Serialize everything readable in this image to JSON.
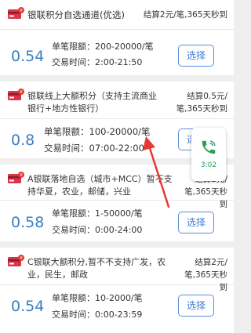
{
  "channels": [
    {
      "name": "银联积分自选通道(优选)",
      "settlement": "结算2元/笔,365天秒到",
      "rate": "0.54",
      "limit": "单笔限额：200-20000/笔",
      "hours": "交易时间：2:00-21:50",
      "button": "选择"
    },
    {
      "name": "银联线上大额积分（支持主流商业银行+地方性银行）",
      "settlement": "结算0.5元/笔,365天秒到",
      "rate": "0.8",
      "limit": "单笔限额：100-20000/笔",
      "hours": "交易时间：07:00-22:00",
      "button": "选择"
    },
    {
      "name": "A银联落地自选（城市+MCC）暂不支持华夏，农业，邮储，兴业",
      "settlement": "结算2元/笔,365天秒到",
      "rate": "0.58",
      "limit": "单笔限额：1-50000/笔",
      "hours": "交易时间：0:00-24:00",
      "button": "选择"
    },
    {
      "name": "C银联大额积分,暂不不支持广发，农业，民生，邮政",
      "settlement": "结算2元/笔,365天秒到",
      "rate": "0.54",
      "limit": "单笔限额：10-2000/笔",
      "hours": "交易时间：0:00-23:59",
      "button": "选择"
    }
  ],
  "call_bubble": {
    "time": "3:02",
    "icon": "phone-icon",
    "color": "#2a9d5a"
  },
  "annotation": {
    "icon": "red-arrow",
    "color": "#e53935"
  },
  "colors": {
    "rate": "#3a7fc2",
    "button_border": "#5b8fd6",
    "card_icon": "#d9344a"
  }
}
